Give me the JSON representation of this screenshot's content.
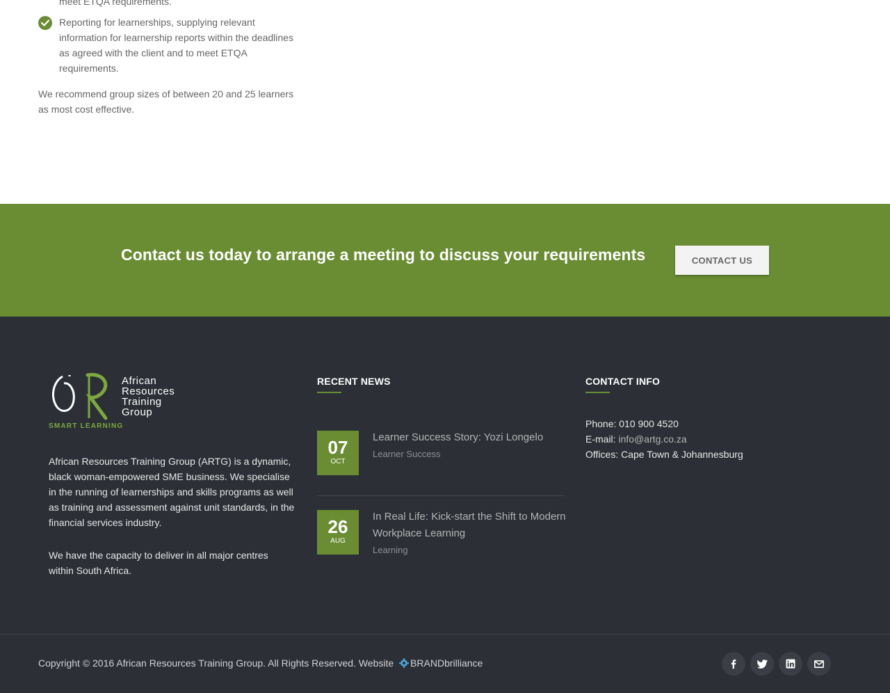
{
  "content": {
    "partial_line": "meet ETQA requirements.",
    "check_item": "Reporting for learnerships, supplying relevant information for learnership reports within the deadlines as agreed with the client and to meet ETQA requirements.",
    "recommendation": "We recommend group sizes of between 20 and 25 learners as most cost effective."
  },
  "cta": {
    "text": "Contact us today to arrange a meeting to discuss your requirements",
    "button_label": "CONTACT US"
  },
  "footer": {
    "logo": {
      "line1": "African",
      "line2": "Resources",
      "line3": "Training",
      "line4": "Group",
      "tagline": "SMART LEARNING"
    },
    "about_1": "African Resources Training Group (ARTG) is a dynamic, black woman-empowered SME business. We specialise in the running of learnerships and skills programs as well as training and assessment against unit standards, in the financial services industry.",
    "about_2": "We have the capacity to deliver in all major centres within South Africa.",
    "recent_news": {
      "title": "RECENT NEWS",
      "items": [
        {
          "day": "07",
          "month": "OCT",
          "title": "Learner Success Story: Yozi Longelo",
          "category": "Learner Success"
        },
        {
          "day": "26",
          "month": "AUG",
          "title": "In Real Life: Kick-start the Shift to Modern Workplace Learning",
          "category": "Learning"
        }
      ]
    },
    "contact_info": {
      "title": "CONTACT INFO",
      "phone": "Phone: 010 900 4520",
      "email_label": "E-mail:",
      "email": "info@artg.co.za",
      "offices": "Offices: Cape Town & Johannesburg"
    }
  },
  "bottom_bar": {
    "copyright": "Copyright © 2016 African Resources Training Group. All Rights Reserved. Website",
    "brand": "BRANDbrilliance",
    "social": [
      "facebook-icon",
      "twitter-icon",
      "linkedin-icon",
      "email-icon"
    ]
  },
  "colors": {
    "accent_green": "#6a8d33",
    "footer_bg": "#2c3036"
  }
}
